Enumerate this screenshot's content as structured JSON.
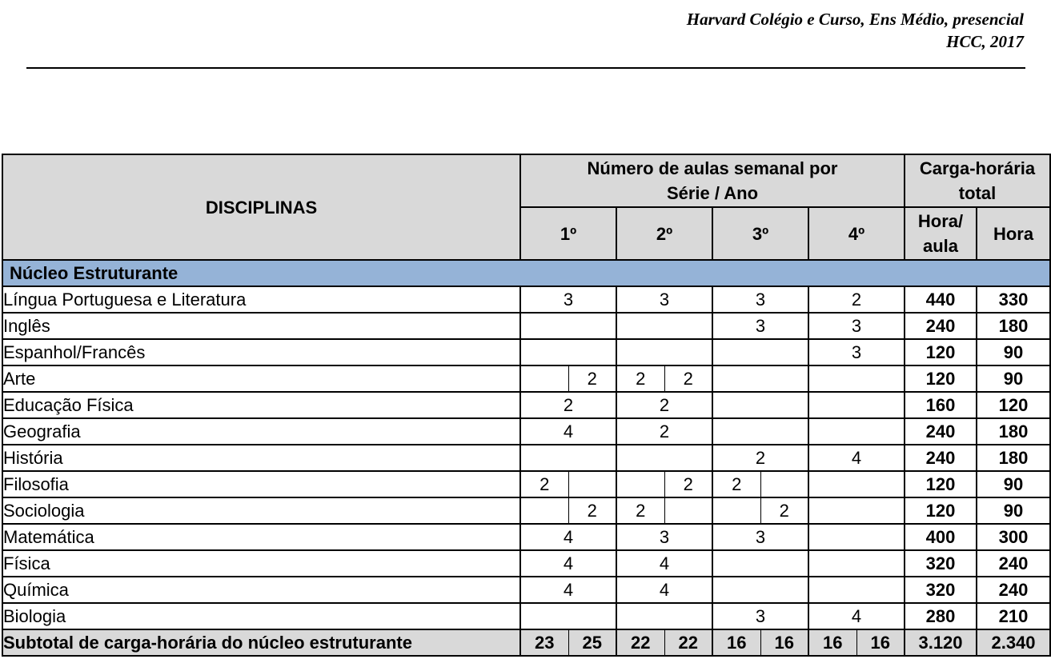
{
  "header": {
    "line1": "Harvard Colégio e Curso, Ens Médio, presencial",
    "line2": "HCC, 2017"
  },
  "table": {
    "col_disciplinas": "DISCIPLINAS",
    "col_aulas_line1": "Número de aulas semanal por",
    "col_aulas_line2": "Série / Ano",
    "col_carga_line1": "Carga-horária",
    "col_carga_line2": "total",
    "series": [
      "1º",
      "2º",
      "3º",
      "4º"
    ],
    "col_hora_aula_line1": "Hora/",
    "col_hora_aula_line2": "aula",
    "col_hora": "Hora",
    "section": "Núcleo Estruturante",
    "rows": [
      {
        "name": "Língua Portuguesa e Literatura",
        "s1": "3",
        "s2": "3",
        "s3": "3",
        "s4": "2",
        "hora_aula": "440",
        "hora": "330"
      },
      {
        "name": "Inglês",
        "s1": "",
        "s2": "",
        "s3": "3",
        "s4": "3",
        "hora_aula": "240",
        "hora": "180"
      },
      {
        "name": "Espanhol/Francês",
        "s1": "",
        "s2": "",
        "s3": "",
        "s4": "3",
        "hora_aula": "120",
        "hora": "90"
      },
      {
        "name": "Arte",
        "s1a": "",
        "s1b": "2",
        "s2a": "2",
        "s2b": "2",
        "s3": "",
        "s4": "",
        "hora_aula": "120",
        "hora": "90"
      },
      {
        "name": "Educação Física",
        "s1": "2",
        "s2": "2",
        "s3": "",
        "s4": "",
        "hora_aula": "160",
        "hora": "120"
      },
      {
        "name": "Geografia",
        "s1": "4",
        "s2": "2",
        "s3": "",
        "s4": "",
        "hora_aula": "240",
        "hora": "180"
      },
      {
        "name": "História",
        "s1": "",
        "s2": "",
        "s3": "2",
        "s4": "4",
        "hora_aula": "240",
        "hora": "180"
      },
      {
        "name": "Filosofia",
        "s1a": "2",
        "s1b": "",
        "s2a": "",
        "s2b": "2",
        "s3a": "2",
        "s3b": "",
        "s4": "",
        "hora_aula": "120",
        "hora": "90"
      },
      {
        "name": "Sociologia",
        "s1a": "",
        "s1b": "2",
        "s2a": "2",
        "s2b": "",
        "s3a": "",
        "s3b": "2",
        "s4": "",
        "hora_aula": "120",
        "hora": "90"
      },
      {
        "name": "Matemática",
        "s1": "4",
        "s2": "3",
        "s3": "3",
        "s4": "",
        "hora_aula": "400",
        "hora": "300"
      },
      {
        "name": "Física",
        "s1": "4",
        "s2": "4",
        "s3": "",
        "s4": "",
        "hora_aula": "320",
        "hora": "240"
      },
      {
        "name": "Química",
        "s1": "4",
        "s2": "4",
        "s3": "",
        "s4": "",
        "hora_aula": "320",
        "hora": "240"
      },
      {
        "name": "Biologia",
        "s1": "",
        "s2": "",
        "s3": "3",
        "s4": "4",
        "hora_aula": "280",
        "hora": "210"
      }
    ],
    "subtotal": {
      "name": "Subtotal de carga-horária do núcleo estruturante",
      "values": [
        "23",
        "25",
        "22",
        "22",
        "16",
        "16",
        "16",
        "16"
      ],
      "hora_aula": "3.120",
      "hora": "2.340"
    }
  }
}
